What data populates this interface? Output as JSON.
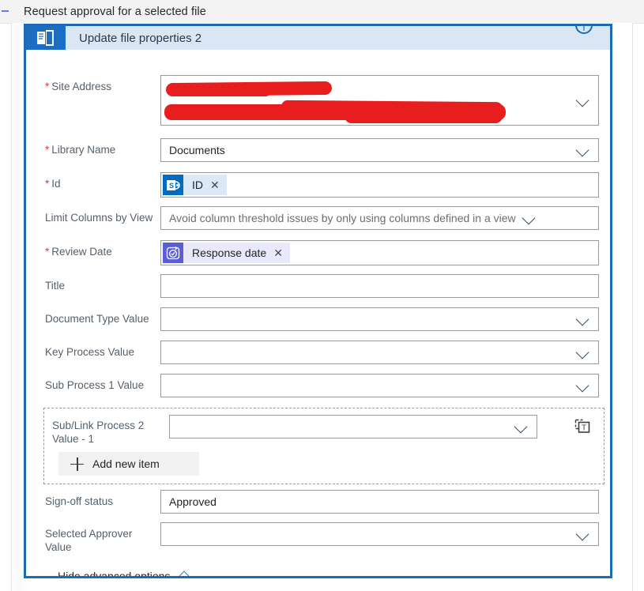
{
  "titlebar": {
    "back_icon": "back-arrow-icon",
    "title": "Request approval for a selected file"
  },
  "card": {
    "header": {
      "icon": "sharepoint-update-file-icon",
      "title": "Update file properties 2",
      "info_icon": "info-icon",
      "info_glyph": "i"
    },
    "accent_color": "#1a6cb5",
    "header_bg": "#dae6f3",
    "icon_bg": "#1b6ec2"
  },
  "fields": [
    {
      "key": "site_address",
      "label": "Site Address",
      "required": true,
      "type": "combo-redacted",
      "value": "",
      "redacted": true,
      "chevron": true
    },
    {
      "key": "library_name",
      "label": "Library Name",
      "required": true,
      "type": "combo",
      "value": "Documents",
      "chevron": true
    },
    {
      "key": "id",
      "label": "Id",
      "required": true,
      "type": "token",
      "token": {
        "text": "ID",
        "icon": "sharepoint-icon",
        "remove_icon": "close-icon"
      }
    },
    {
      "key": "limit_columns_by_view",
      "label": "Limit Columns by View",
      "required": false,
      "type": "combo",
      "placeholder": "Avoid column threshold issues by only using columns defined in a view",
      "chevron": true,
      "chevron_inline": true
    },
    {
      "key": "review_date",
      "label": "Review Date",
      "required": true,
      "type": "token",
      "token": {
        "text": "Response date",
        "icon": "approvals-icon",
        "remove_icon": "close-icon"
      }
    },
    {
      "key": "title",
      "label": "Title",
      "required": false,
      "type": "text",
      "value": ""
    },
    {
      "key": "document_type_value",
      "label": "Document Type Value",
      "required": false,
      "type": "combo",
      "value": "",
      "chevron": true
    },
    {
      "key": "key_process_value",
      "label": "Key Process Value",
      "required": false,
      "type": "combo",
      "value": "",
      "chevron": true
    },
    {
      "key": "sub_process_1_value",
      "label": "Sub Process 1 Value",
      "required": false,
      "type": "combo",
      "value": "",
      "chevron": true
    }
  ],
  "repeating_group": {
    "label": "Sub/Link Process 2 Value - 1",
    "value": "",
    "chevron": true,
    "switch_icon": "switch-to-text-mode-icon",
    "add_button": {
      "label": "Add new item",
      "icon": "plus-icon"
    }
  },
  "fields_after": [
    {
      "key": "sign_off_status",
      "label": "Sign-off status",
      "required": false,
      "type": "text",
      "value": "Approved"
    },
    {
      "key": "selected_approver_value",
      "label": "Selected Approver Value",
      "required": false,
      "type": "combo",
      "value": "",
      "chevron": true
    }
  ],
  "advanced_toggle": {
    "label": "Hide advanced options",
    "icon": "chevron-up-icon"
  }
}
